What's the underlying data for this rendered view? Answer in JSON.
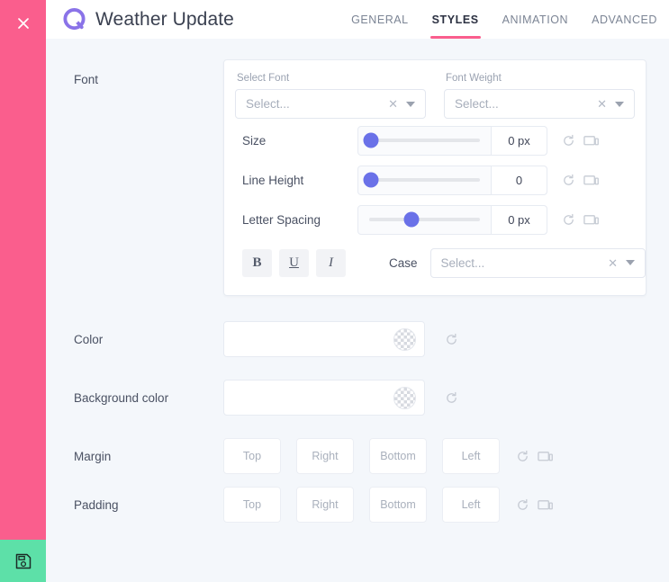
{
  "window": {
    "title": "Weather Update",
    "logo_icon": "quform-q-logo-icon",
    "close_icon": "close-icon",
    "save_icon": "save-floppy-disk-icon",
    "accent_pink": "#fa5e8d",
    "accent_green": "#5de0a8",
    "slider_purple": "#6a71e8",
    "content_bg": "#f4f7fb"
  },
  "tabs": [
    {
      "label": "GENERAL",
      "active": false
    },
    {
      "label": "STYLES",
      "active": true
    },
    {
      "label": "ANIMATION",
      "active": false
    },
    {
      "label": "ADVANCED",
      "active": false
    }
  ],
  "font_section": {
    "label": "Font",
    "select_font": {
      "caption": "Select Font",
      "value": "",
      "placeholder": "Select...",
      "clear_icon": "clear-x-icon",
      "caret_icon": "chevron-down-icon"
    },
    "font_weight": {
      "caption": "Font Weight",
      "value": "",
      "placeholder": "Select...",
      "clear_icon": "clear-x-icon",
      "caret_icon": "chevron-down-icon"
    },
    "sliders": [
      {
        "label": "Size",
        "value": "0 px",
        "percent": 2,
        "reset_icon": "reset-icon",
        "device_icon": "responsive-device-icon"
      },
      {
        "label": "Line Height",
        "value": "0",
        "percent": 2,
        "reset_icon": "reset-icon",
        "device_icon": "responsive-device-icon"
      },
      {
        "label": "Letter Spacing",
        "value": "0 px",
        "percent": 38,
        "reset_icon": "reset-icon",
        "device_icon": "responsive-device-icon"
      }
    ],
    "style_buttons": [
      {
        "label": "B",
        "name": "bold"
      },
      {
        "label": "U",
        "name": "underline"
      },
      {
        "label": "I",
        "name": "italic"
      }
    ],
    "case": {
      "label": "Case",
      "value": "",
      "placeholder": "Select...",
      "clear_icon": "clear-x-icon",
      "caret_icon": "chevron-down-icon"
    }
  },
  "color_section": {
    "color": {
      "label": "Color",
      "swatch_icon": "transparent-checker-swatch",
      "reset_icon": "reset-icon"
    },
    "background_color": {
      "label": "Background color",
      "swatch_icon": "transparent-checker-swatch",
      "reset_icon": "reset-icon"
    }
  },
  "spacing_section": {
    "margin": {
      "label": "Margin",
      "fields": [
        {
          "placeholder": "Top",
          "value": ""
        },
        {
          "placeholder": "Right",
          "value": ""
        },
        {
          "placeholder": "Bottom",
          "value": ""
        },
        {
          "placeholder": "Left",
          "value": ""
        }
      ],
      "reset_icon": "reset-icon",
      "device_icon": "responsive-device-icon"
    },
    "padding": {
      "label": "Padding",
      "fields": [
        {
          "placeholder": "Top",
          "value": ""
        },
        {
          "placeholder": "Right",
          "value": ""
        },
        {
          "placeholder": "Bottom",
          "value": ""
        },
        {
          "placeholder": "Left",
          "value": ""
        }
      ],
      "reset_icon": "reset-icon",
      "device_icon": "responsive-device-icon"
    }
  }
}
